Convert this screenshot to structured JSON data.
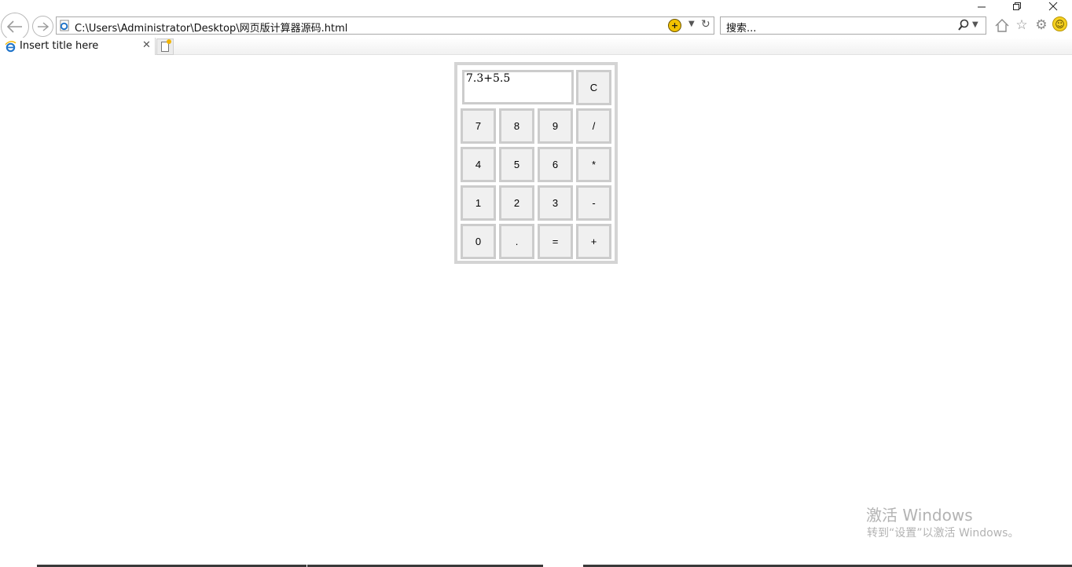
{
  "window": {
    "minimize_icon": "minimize-icon",
    "maximize_icon": "restore-icon",
    "close_icon": "close-icon"
  },
  "nav": {
    "back_icon": "back-arrow-icon",
    "forward_icon": "forward-arrow-icon"
  },
  "address": {
    "url": "C:\\Users\\Administrator\\Desktop\\网页版计算器源码.html"
  },
  "search": {
    "placeholder": "搜索..."
  },
  "toolbar": {
    "icons": [
      "home-icon",
      "favorites-star-icon",
      "tools-gear-icon",
      "feedback-smiley-icon"
    ]
  },
  "tabs": [
    {
      "title": "Insert title here",
      "active": true
    }
  ],
  "calculator": {
    "display": "7.3+5.5",
    "clear_label": "C",
    "keys": [
      [
        "7",
        "8",
        "9",
        "/"
      ],
      [
        "4",
        "5",
        "6",
        "*"
      ],
      [
        "1",
        "2",
        "3",
        "-"
      ],
      [
        "0",
        ".",
        "=",
        "+"
      ]
    ]
  },
  "watermark": {
    "title": "激活 Windows",
    "subtitle": "转到“设置”以激活 Windows。"
  },
  "colors": {
    "calc_border": "#d4d4d4",
    "button_bg": "#f0f0f0",
    "watermark": "#b3b3b3"
  }
}
